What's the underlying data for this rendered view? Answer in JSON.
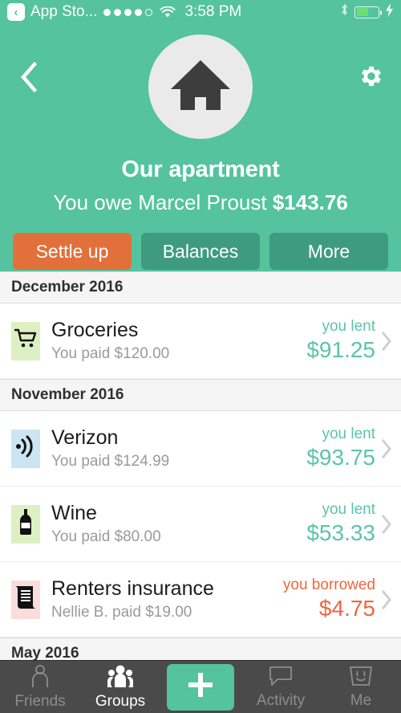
{
  "statusbar": {
    "back_badge": "‹",
    "carrier": "App Sto...",
    "signal_dots": 5,
    "signal_filled": 4,
    "wifi_icon": "wifi-icon",
    "time": "3:58 PM",
    "bluetooth_icon": "bluetooth-icon",
    "battery_icon": "battery-icon",
    "battery_level_pct": 55,
    "charging_icon": "lightning-bolt-icon"
  },
  "header": {
    "back_icon": "chevron-left-icon",
    "settings_icon": "gear-icon",
    "avatar_icon": "house-icon",
    "group_title": "Our apartment",
    "balance_prefix": "You owe Marcel Proust ",
    "balance_amount": "$143.76",
    "background_color": "#54c39e",
    "buttons": [
      {
        "label": "Settle up",
        "style": "primary",
        "color": "#e2703a"
      },
      {
        "label": "Balances",
        "style": "secondary",
        "color": "#3e9b80"
      },
      {
        "label": "More",
        "style": "secondary",
        "color": "#3e9b80"
      }
    ]
  },
  "list": {
    "sections": [
      {
        "header": "December 2016",
        "items": [
          {
            "icon": "shopping-cart-icon",
            "icon_bg": "#ddf0c3",
            "title": "Groceries",
            "subtitle": "You paid $120.00",
            "side_label": "you lent",
            "amount": "$91.25",
            "direction": "lent",
            "chevron_icon": "chevron-right-icon"
          }
        ]
      },
      {
        "header": "November 2016",
        "items": [
          {
            "icon": "signal-waves-icon",
            "icon_bg": "#cbe5f2",
            "title": "Verizon",
            "subtitle": "You paid $124.99",
            "side_label": "you lent",
            "amount": "$93.75",
            "direction": "lent",
            "chevron_icon": "chevron-right-icon"
          },
          {
            "icon": "wine-bottle-icon",
            "icon_bg": "#ddf0c3",
            "title": "Wine",
            "subtitle": "You paid $80.00",
            "side_label": "you lent",
            "amount": "$53.33",
            "direction": "lent",
            "chevron_icon": "chevron-right-icon"
          },
          {
            "icon": "document-scroll-icon",
            "icon_bg": "#f9dcdc",
            "title": "Renters insurance",
            "subtitle": "Nellie B. paid $19.00",
            "side_label": "you borrowed",
            "amount": "$4.75",
            "direction": "borrowed",
            "chevron_icon": "chevron-right-icon"
          }
        ]
      },
      {
        "header": "May 2016",
        "items": []
      }
    ]
  },
  "tabbar": {
    "tabs": [
      {
        "label": "Friends",
        "icon": "person-outline-icon",
        "active": false
      },
      {
        "label": "Groups",
        "icon": "people-group-icon",
        "active": true
      }
    ],
    "add_button": {
      "icon": "plus-icon",
      "color": "#54c39e"
    },
    "tabs_right": [
      {
        "label": "Activity",
        "icon": "speech-bubble-icon",
        "active": false
      },
      {
        "label": "Me",
        "icon": "smiley-face-icon",
        "active": false
      }
    ]
  }
}
